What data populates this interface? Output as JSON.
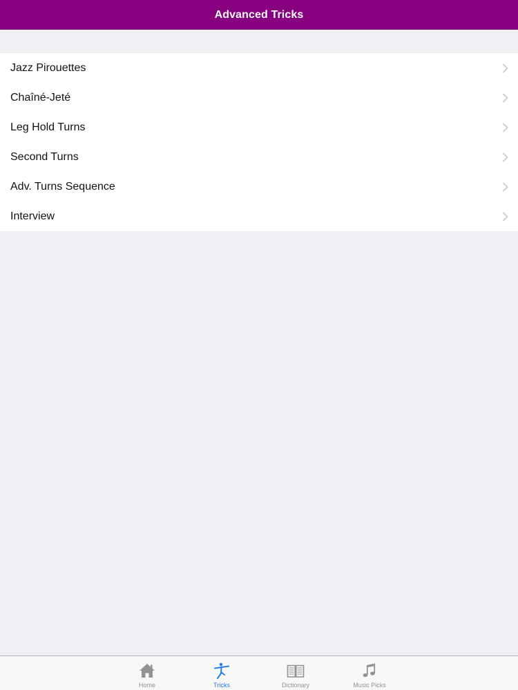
{
  "nav": {
    "title": "Advanced Tricks",
    "background": "#87007f"
  },
  "list": {
    "items": [
      {
        "label": "Jazz Pirouettes"
      },
      {
        "label": "Chaîné-Jeté"
      },
      {
        "label": "Leg Hold Turns"
      },
      {
        "label": "Second Turns"
      },
      {
        "label": "Adv. Turns Sequence"
      },
      {
        "label": "Interview"
      }
    ],
    "disclosure_icon": "chevron-right-icon"
  },
  "tabbar": {
    "active_color": "#1f7ee8",
    "inactive_color": "#929292",
    "tabs": [
      {
        "label": "Home",
        "icon": "home-icon",
        "active": false
      },
      {
        "label": "Tricks",
        "icon": "dancer-icon",
        "active": true
      },
      {
        "label": "Dictionary",
        "icon": "book-icon",
        "active": false
      },
      {
        "label": "Music Picks",
        "icon": "music-note-icon",
        "active": false
      }
    ]
  }
}
